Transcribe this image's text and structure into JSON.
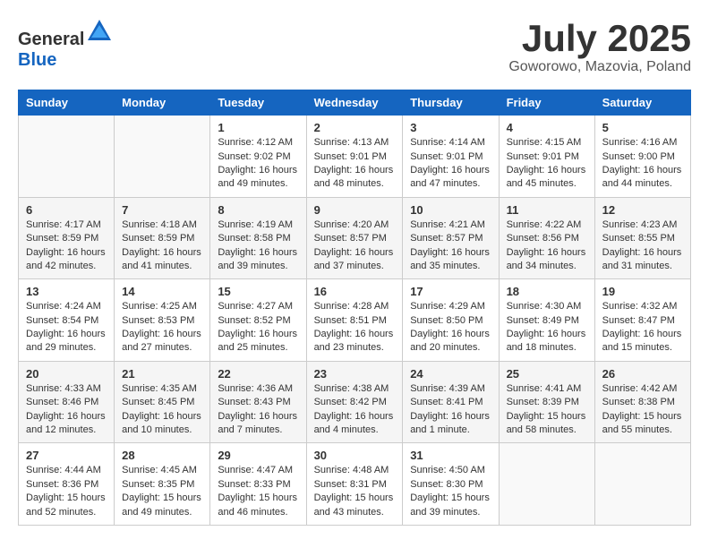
{
  "header": {
    "logo_general": "General",
    "logo_blue": "Blue",
    "month_year": "July 2025",
    "location": "Goworowo, Mazovia, Poland"
  },
  "weekdays": [
    "Sunday",
    "Monday",
    "Tuesday",
    "Wednesday",
    "Thursday",
    "Friday",
    "Saturday"
  ],
  "weeks": [
    [
      {
        "day": "",
        "empty": true
      },
      {
        "day": "",
        "empty": true
      },
      {
        "day": "1",
        "sunrise": "Sunrise: 4:12 AM",
        "sunset": "Sunset: 9:02 PM",
        "daylight": "Daylight: 16 hours and 49 minutes."
      },
      {
        "day": "2",
        "sunrise": "Sunrise: 4:13 AM",
        "sunset": "Sunset: 9:01 PM",
        "daylight": "Daylight: 16 hours and 48 minutes."
      },
      {
        "day": "3",
        "sunrise": "Sunrise: 4:14 AM",
        "sunset": "Sunset: 9:01 PM",
        "daylight": "Daylight: 16 hours and 47 minutes."
      },
      {
        "day": "4",
        "sunrise": "Sunrise: 4:15 AM",
        "sunset": "Sunset: 9:01 PM",
        "daylight": "Daylight: 16 hours and 45 minutes."
      },
      {
        "day": "5",
        "sunrise": "Sunrise: 4:16 AM",
        "sunset": "Sunset: 9:00 PM",
        "daylight": "Daylight: 16 hours and 44 minutes."
      }
    ],
    [
      {
        "day": "6",
        "sunrise": "Sunrise: 4:17 AM",
        "sunset": "Sunset: 8:59 PM",
        "daylight": "Daylight: 16 hours and 42 minutes."
      },
      {
        "day": "7",
        "sunrise": "Sunrise: 4:18 AM",
        "sunset": "Sunset: 8:59 PM",
        "daylight": "Daylight: 16 hours and 41 minutes."
      },
      {
        "day": "8",
        "sunrise": "Sunrise: 4:19 AM",
        "sunset": "Sunset: 8:58 PM",
        "daylight": "Daylight: 16 hours and 39 minutes."
      },
      {
        "day": "9",
        "sunrise": "Sunrise: 4:20 AM",
        "sunset": "Sunset: 8:57 PM",
        "daylight": "Daylight: 16 hours and 37 minutes."
      },
      {
        "day": "10",
        "sunrise": "Sunrise: 4:21 AM",
        "sunset": "Sunset: 8:57 PM",
        "daylight": "Daylight: 16 hours and 35 minutes."
      },
      {
        "day": "11",
        "sunrise": "Sunrise: 4:22 AM",
        "sunset": "Sunset: 8:56 PM",
        "daylight": "Daylight: 16 hours and 34 minutes."
      },
      {
        "day": "12",
        "sunrise": "Sunrise: 4:23 AM",
        "sunset": "Sunset: 8:55 PM",
        "daylight": "Daylight: 16 hours and 31 minutes."
      }
    ],
    [
      {
        "day": "13",
        "sunrise": "Sunrise: 4:24 AM",
        "sunset": "Sunset: 8:54 PM",
        "daylight": "Daylight: 16 hours and 29 minutes."
      },
      {
        "day": "14",
        "sunrise": "Sunrise: 4:25 AM",
        "sunset": "Sunset: 8:53 PM",
        "daylight": "Daylight: 16 hours and 27 minutes."
      },
      {
        "day": "15",
        "sunrise": "Sunrise: 4:27 AM",
        "sunset": "Sunset: 8:52 PM",
        "daylight": "Daylight: 16 hours and 25 minutes."
      },
      {
        "day": "16",
        "sunrise": "Sunrise: 4:28 AM",
        "sunset": "Sunset: 8:51 PM",
        "daylight": "Daylight: 16 hours and 23 minutes."
      },
      {
        "day": "17",
        "sunrise": "Sunrise: 4:29 AM",
        "sunset": "Sunset: 8:50 PM",
        "daylight": "Daylight: 16 hours and 20 minutes."
      },
      {
        "day": "18",
        "sunrise": "Sunrise: 4:30 AM",
        "sunset": "Sunset: 8:49 PM",
        "daylight": "Daylight: 16 hours and 18 minutes."
      },
      {
        "day": "19",
        "sunrise": "Sunrise: 4:32 AM",
        "sunset": "Sunset: 8:47 PM",
        "daylight": "Daylight: 16 hours and 15 minutes."
      }
    ],
    [
      {
        "day": "20",
        "sunrise": "Sunrise: 4:33 AM",
        "sunset": "Sunset: 8:46 PM",
        "daylight": "Daylight: 16 hours and 12 minutes."
      },
      {
        "day": "21",
        "sunrise": "Sunrise: 4:35 AM",
        "sunset": "Sunset: 8:45 PM",
        "daylight": "Daylight: 16 hours and 10 minutes."
      },
      {
        "day": "22",
        "sunrise": "Sunrise: 4:36 AM",
        "sunset": "Sunset: 8:43 PM",
        "daylight": "Daylight: 16 hours and 7 minutes."
      },
      {
        "day": "23",
        "sunrise": "Sunrise: 4:38 AM",
        "sunset": "Sunset: 8:42 PM",
        "daylight": "Daylight: 16 hours and 4 minutes."
      },
      {
        "day": "24",
        "sunrise": "Sunrise: 4:39 AM",
        "sunset": "Sunset: 8:41 PM",
        "daylight": "Daylight: 16 hours and 1 minute."
      },
      {
        "day": "25",
        "sunrise": "Sunrise: 4:41 AM",
        "sunset": "Sunset: 8:39 PM",
        "daylight": "Daylight: 15 hours and 58 minutes."
      },
      {
        "day": "26",
        "sunrise": "Sunrise: 4:42 AM",
        "sunset": "Sunset: 8:38 PM",
        "daylight": "Daylight: 15 hours and 55 minutes."
      }
    ],
    [
      {
        "day": "27",
        "sunrise": "Sunrise: 4:44 AM",
        "sunset": "Sunset: 8:36 PM",
        "daylight": "Daylight: 15 hours and 52 minutes."
      },
      {
        "day": "28",
        "sunrise": "Sunrise: 4:45 AM",
        "sunset": "Sunset: 8:35 PM",
        "daylight": "Daylight: 15 hours and 49 minutes."
      },
      {
        "day": "29",
        "sunrise": "Sunrise: 4:47 AM",
        "sunset": "Sunset: 8:33 PM",
        "daylight": "Daylight: 15 hours and 46 minutes."
      },
      {
        "day": "30",
        "sunrise": "Sunrise: 4:48 AM",
        "sunset": "Sunset: 8:31 PM",
        "daylight": "Daylight: 15 hours and 43 minutes."
      },
      {
        "day": "31",
        "sunrise": "Sunrise: 4:50 AM",
        "sunset": "Sunset: 8:30 PM",
        "daylight": "Daylight: 15 hours and 39 minutes."
      },
      {
        "day": "",
        "empty": true
      },
      {
        "day": "",
        "empty": true
      }
    ]
  ]
}
